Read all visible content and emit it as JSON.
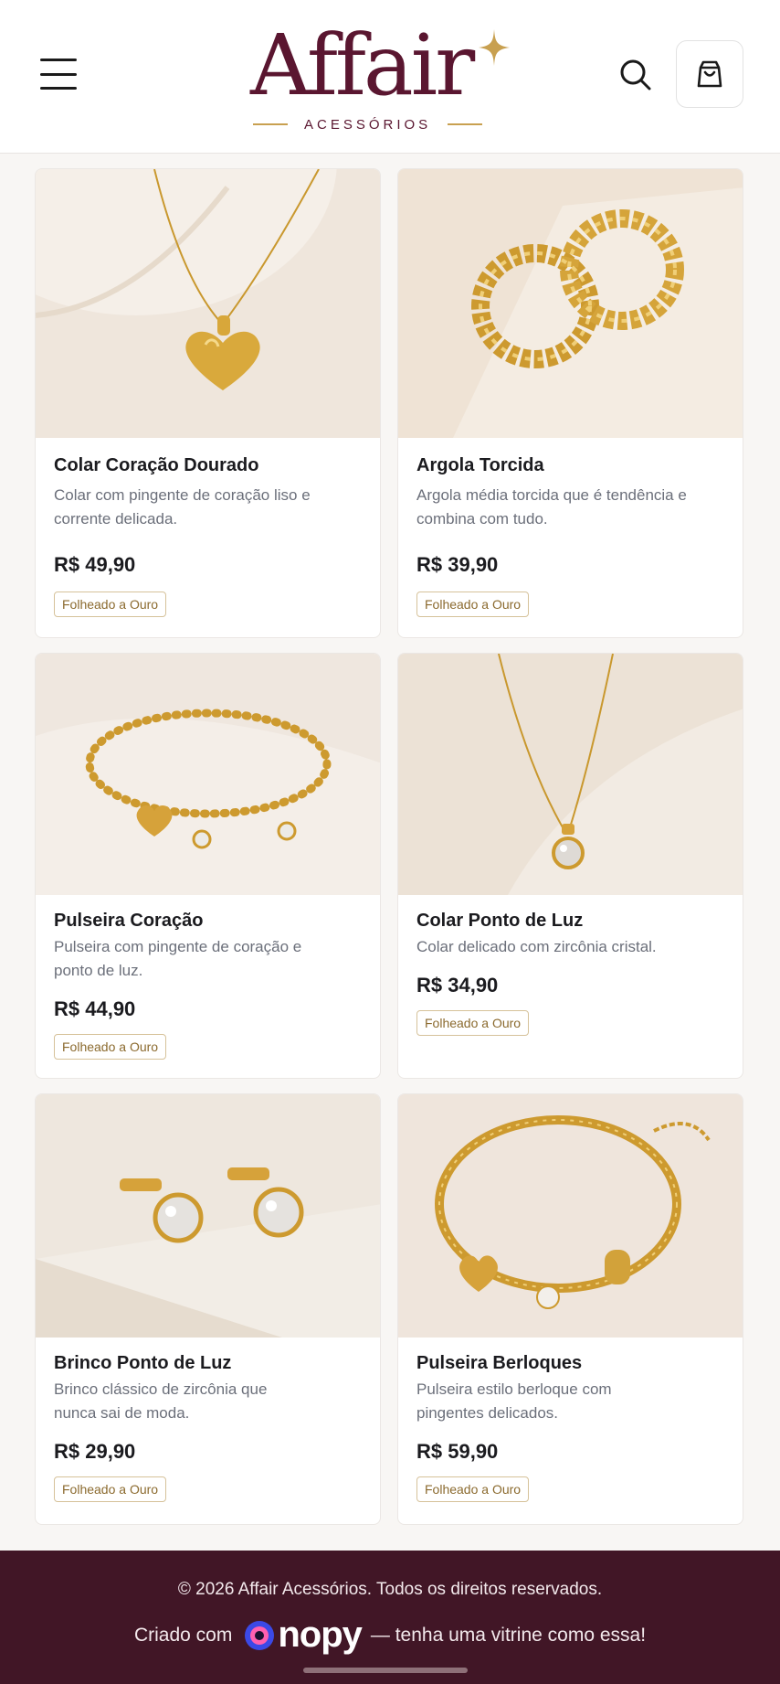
{
  "header": {
    "logo_word": "Affair",
    "logo_sub": "ACESSÓRIOS",
    "colors": {
      "brand": "#5a1630",
      "gold": "#c8a050"
    },
    "icons": {
      "menu": "hamburger-icon",
      "search": "search-icon",
      "cart": "shopping-bag-icon"
    }
  },
  "products": [
    {
      "title": "Colar Coração Dourado",
      "desc": "Colar com pingente de coração liso e corrente delicada.",
      "price": "R$ 49,90",
      "tag": "Folheado a Ouro"
    },
    {
      "title": "Argola Torcida",
      "desc": "Argola média torcida que é tendência e combina com tudo.",
      "price": "R$ 39,90",
      "tag": "Folheado a Ouro"
    },
    {
      "title": "Pulseira Coração",
      "desc": "Pulseira com pingente de coração e ponto de luz.",
      "price": "R$ 44,90",
      "tag": "Folheado a Ouro"
    },
    {
      "title": "Colar Ponto de Luz",
      "desc": "Colar delicado com zircônia cristal.",
      "price": "R$ 34,90",
      "tag": "Folheado a Ouro"
    },
    {
      "title": "Brinco Ponto de Luz",
      "desc": "Brinco clássico de zircônia que nunca sai de moda.",
      "price": "R$ 29,90",
      "tag": "Folheado a Ouro"
    },
    {
      "title": "Pulseira Berloques",
      "desc": "Pulseira estilo berloque com pingentes delicados.",
      "price": "R$ 59,90",
      "tag": "Folheado a Ouro"
    }
  ],
  "footer": {
    "copyright": "© 2026 Affair Acessórios. Todos os direitos reservados.",
    "credit_prefix": "Criado com",
    "brand": "nopy",
    "credit_suffix": "— tenha uma vitrine como essa!"
  }
}
